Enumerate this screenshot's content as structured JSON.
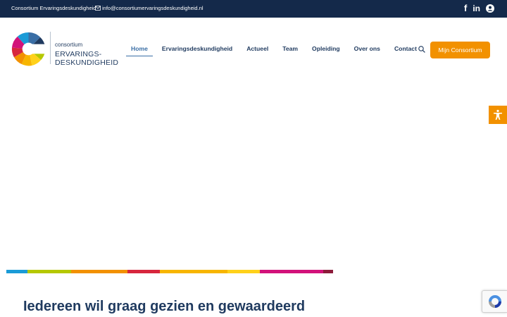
{
  "topbar": {
    "organization": "Consortium Ervaringsdeskundigheid",
    "email": "info@consortiumervaringsdeskundigheid.nl",
    "social": [
      "facebook-icon",
      "linkedin-icon",
      "account-icon"
    ],
    "social_labels": {
      "facebook": "f",
      "linkedin": "in"
    }
  },
  "logo": {
    "small": "consortium",
    "line1": "ERVARINGS-",
    "line2": "DESKUNDIGHEID"
  },
  "nav": {
    "items": [
      {
        "label": "Home",
        "active": true
      },
      {
        "label": "Ervaringsdeskundigheid",
        "active": false
      },
      {
        "label": "Actueel",
        "active": false
      },
      {
        "label": "Team",
        "active": false
      },
      {
        "label": "Opleiding",
        "active": false
      },
      {
        "label": "Over ons",
        "active": false
      },
      {
        "label": "Contact",
        "active": false
      }
    ],
    "search_icon": "search-icon",
    "cta_label": "Mijn Consortium"
  },
  "accessibility_icon": "accessibility-icon",
  "stripe_colors": [
    "#1b9bd7",
    "#b5c800",
    "#f29100",
    "#d7263d",
    "#f7b500",
    "#ffd11a",
    "#d2127a",
    "#8c1c3a"
  ],
  "hero": {
    "headline": "Iedereen wil graag gezien en gewaardeerd"
  },
  "recaptcha_icon": "recaptcha-icon",
  "colors": {
    "navy": "#14294a",
    "text": "#1f3a5f",
    "accent": "#f29100",
    "active": "#3a6ea5"
  }
}
